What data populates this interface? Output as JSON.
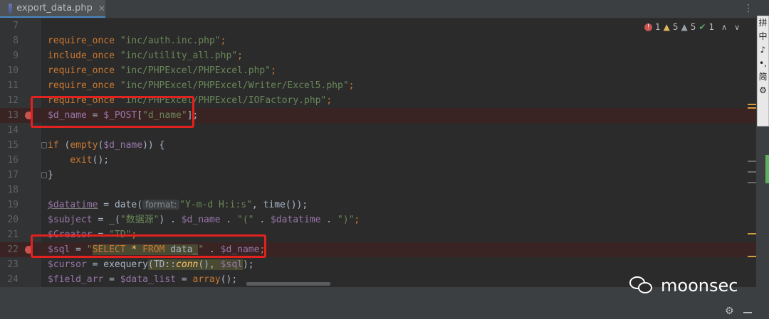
{
  "tab": {
    "label": "export_data.php",
    "close": "✕"
  },
  "inspections": {
    "errors": "1",
    "warnings": "5",
    "weak_warnings": "5",
    "typos": "1"
  },
  "lines": [
    {
      "n": "7"
    },
    {
      "n": "8"
    },
    {
      "n": "9"
    },
    {
      "n": "10"
    },
    {
      "n": "11"
    },
    {
      "n": "12"
    },
    {
      "n": "13"
    },
    {
      "n": "14"
    },
    {
      "n": "15"
    },
    {
      "n": "16"
    },
    {
      "n": "17"
    },
    {
      "n": "18"
    },
    {
      "n": "19"
    },
    {
      "n": "20"
    },
    {
      "n": "21"
    },
    {
      "n": "22"
    },
    {
      "n": "23"
    },
    {
      "n": "24"
    }
  ],
  "code": {
    "l8": [
      "require_once",
      " ",
      "\"inc/auth.inc.php\"",
      ";"
    ],
    "l9": [
      "include_once",
      " ",
      "\"inc/utility_all.php\"",
      ";"
    ],
    "l10": [
      "require_once",
      " ",
      "\"inc/PHPExcel/PHPExcel.php\"",
      ";"
    ],
    "l11": [
      "require_once",
      " ",
      "\"inc/PHPExcel/PHPExcel/Writer/Excel5.php\"",
      ";"
    ],
    "l12": [
      "require_once",
      " ",
      "\"inc/PHPExcel/PHPExcel/IOFactory.php\"",
      ";"
    ],
    "l13": [
      "$d_name",
      " = ",
      "$_POST",
      "[",
      "\"d_name\"",
      "];"
    ],
    "l15": [
      "if",
      " (",
      "empty",
      "(",
      "$d_name",
      ")) {"
    ],
    "l16": [
      "    ",
      "exit",
      "();"
    ],
    "l17": [
      "}"
    ],
    "l19": [
      "$datatime",
      " = ",
      "date",
      "(",
      "format:",
      "\"Y-m-d H:i:s\"",
      ", ",
      "time",
      "());"
    ],
    "l20": [
      "$subject",
      " = ",
      "_",
      "(",
      "\"数据源\"",
      ") . ",
      "$d_name",
      " . ",
      "\"(\"",
      " . ",
      "$datatime",
      " . ",
      "\")\"",
      ";"
    ],
    "l21": [
      "$Creator",
      " = ",
      "\"TD\"",
      ";"
    ],
    "l22": [
      "$sql",
      " = ",
      "\"",
      "SELECT",
      " * ",
      "FROM",
      " data_",
      "\"",
      " . ",
      "$d_name",
      ";"
    ],
    "l23": [
      "$cursor",
      " = ",
      "exequery",
      "(",
      "TD",
      "::",
      "conn",
      "(), ",
      "$sql",
      ");"
    ],
    "l24": [
      "$field_arr",
      " = ",
      "$data_list",
      " = ",
      "array",
      "();"
    ]
  },
  "ime": [
    "拼",
    "中",
    "♪",
    "•,",
    "简",
    "⚙"
  ],
  "watermark": {
    "text": "moonsec"
  },
  "colors": {
    "keyword": "#cc7832",
    "string": "#6a8759",
    "variable": "#9876aa",
    "function": "#ffc66d",
    "breakpoint": "#c75450",
    "annotation_box": "#e3211f"
  }
}
